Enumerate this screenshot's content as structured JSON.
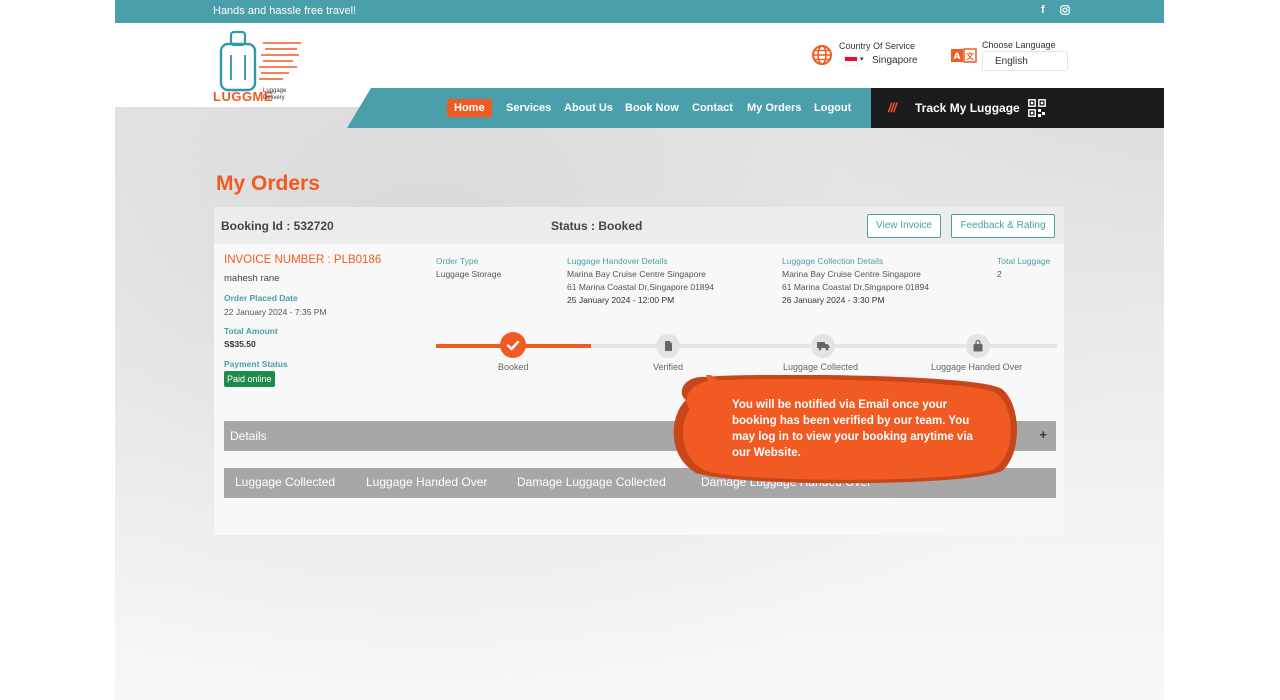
{
  "topbar": {
    "tagline": "Hands and hassle free travel!",
    "social": [
      "facebook-icon",
      "instagram-icon"
    ]
  },
  "logo": {
    "text": "LUGGME",
    "sub": "Luggage Delivery"
  },
  "country": {
    "label": "Country Of Service",
    "value": "Singapore"
  },
  "language": {
    "label": "Choose Language",
    "value": "English"
  },
  "nav": {
    "items": [
      "Home",
      "Services",
      "About Us",
      "Book Now",
      "Contact",
      "My Orders",
      "Logout"
    ],
    "active": "Home"
  },
  "track": {
    "slashes": "///",
    "label": "Track My Luggage"
  },
  "page": {
    "title": "My Orders"
  },
  "order": {
    "booking_id": "Booking Id : 532720",
    "status": "Status : Booked",
    "view_invoice": "View Invoice",
    "feedback": "Feedback & Rating",
    "invoice_number": "INVOICE NUMBER : PLB0186",
    "customer": "mahesh rane",
    "order_placed_label": "Order Placed Date",
    "order_placed": "22 January 2024 - 7:35 PM",
    "total_amount_label": "Total Amount",
    "total_amount": "S$35.50",
    "payment_status_label": "Payment Status",
    "payment_status": "Paid online",
    "order_type_label": "Order Type",
    "order_type": "Luggage Storage",
    "handover_label": "Luggage Handover Details",
    "handover_place": "Marina Bay Cruise Centre Singapore",
    "handover_address": "61 Marina Coastal Dr,Singapore 01894",
    "handover_time": "25 January 2024 - 12:00 PM",
    "collection_label": "Luggage Collection Details",
    "collection_place": "Marina Bay Cruise Centre Singapore",
    "collection_address": "61 Marina Coastal Dr,Singapore 01894",
    "collection_time": "26 January 2024 - 3:30 PM",
    "total_luggage_label": "Total Luggage",
    "total_luggage": "2"
  },
  "progress": {
    "steps": [
      "Booked",
      "Verified",
      "Luggage Collected",
      "Luggage Handed Over"
    ],
    "completed": 1
  },
  "details": {
    "label": "Details",
    "toggle": "+"
  },
  "tabs": [
    "Luggage Collected",
    "Luggage Handed Over",
    "Damage Luggage Collected",
    "Damage Luggage Handed Over"
  ],
  "tooltip": {
    "text": "You will be notified via Email once your booking has been verified by our team. You may log in to view your booking anytime via our Website."
  },
  "colors": {
    "teal": "#4a9faa",
    "orange": "#f15a22",
    "dark": "#1b1b1b",
    "green": "#1e8b4a"
  }
}
